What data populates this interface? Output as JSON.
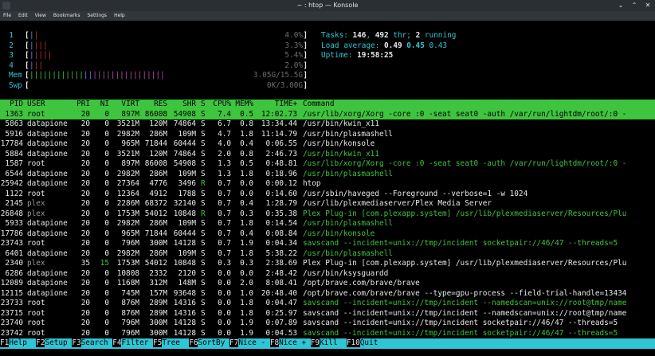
{
  "window": {
    "title": "~ : htop — Konsole"
  },
  "menu": [
    "File",
    "Edit",
    "View",
    "Bookmarks",
    "Settings",
    "Help"
  ],
  "meters": {
    "cpus": [
      {
        "label": "1",
        "value": "4.0%"
      },
      {
        "label": "2",
        "value": "3.3%"
      },
      {
        "label": "3",
        "value": "5.4%"
      },
      {
        "label": "4",
        "value": "2.0%"
      }
    ],
    "mem": {
      "label": "Mem",
      "value": "3.05G/15.5G"
    },
    "swp": {
      "label": "Swp",
      "value": "0K/3.00G"
    }
  },
  "summary": {
    "tasks_label": "Tasks: ",
    "tasks": "146",
    "thr": "492",
    "thr_label": " thr; ",
    "running": "2",
    "running_label": " running",
    "load_label": "Load average: ",
    "load1": "0.49",
    "load5": "0.45",
    "load15": "0.43",
    "uptime_label": "Uptime: ",
    "uptime": "19:58:25"
  },
  "columns": [
    "PID",
    "USER",
    "PRI",
    "NI",
    "VIRT",
    "RES",
    "SHR",
    "S",
    "CPU%",
    "MEM%",
    "TIME+",
    "Command"
  ],
  "processes": [
    {
      "pid": "1363",
      "user": "root",
      "pri": "20",
      "ni": "0",
      "virt": "897M",
      "res": "86008",
      "shr": "54908",
      "s": "S",
      "cpu": "7.4",
      "mem": "0.5",
      "time": "12:02.73",
      "cmd": "/usr/lib/xorg/Xorg -core :0 -seat seat0 -auth /var/run/lightdm/root/:0 -",
      "selected": true,
      "thread": false
    },
    {
      "pid": "5863",
      "user": "datapione",
      "pri": "20",
      "ni": "0",
      "virt": "3521M",
      "res": "120M",
      "shr": "74864",
      "s": "S",
      "cpu": "6.7",
      "mem": "0.8",
      "time": "13:34.44",
      "cmd": "/usr/bin/kwin_x11",
      "selected": false,
      "thread": false
    },
    {
      "pid": "5916",
      "user": "datapione",
      "pri": "20",
      "ni": "0",
      "virt": "2982M",
      "res": "286M",
      "shr": "109M",
      "s": "S",
      "cpu": "4.7",
      "mem": "1.8",
      "time": "11:14.79",
      "cmd": "/usr/bin/plasmashell",
      "selected": false,
      "thread": false
    },
    {
      "pid": "17784",
      "user": "datapione",
      "pri": "20",
      "ni": "0",
      "virt": "965M",
      "res": "71844",
      "shr": "60444",
      "s": "S",
      "cpu": "4.0",
      "mem": "0.4",
      "time": "0:06.55",
      "cmd": "/usr/bin/konsole",
      "selected": false,
      "thread": false
    },
    {
      "pid": "5884",
      "user": "datapione",
      "pri": "20",
      "ni": "0",
      "virt": "3521M",
      "res": "120M",
      "shr": "74864",
      "s": "S",
      "cpu": "2.0",
      "mem": "0.8",
      "time": "2:46.73",
      "cmd": "/usr/bin/kwin_x11",
      "selected": false,
      "thread": true
    },
    {
      "pid": "1587",
      "user": "root",
      "pri": "20",
      "ni": "0",
      "virt": "897M",
      "res": "86008",
      "shr": "54908",
      "s": "S",
      "cpu": "1.3",
      "mem": "0.5",
      "time": "0:48.81",
      "cmd": "/usr/lib/xorg/Xorg -core :0 -seat seat0 -auth /var/run/lightdm/root/:0 -",
      "selected": false,
      "thread": true
    },
    {
      "pid": "6544",
      "user": "datapione",
      "pri": "20",
      "ni": "0",
      "virt": "2982M",
      "res": "286M",
      "shr": "109M",
      "s": "S",
      "cpu": "1.3",
      "mem": "1.8",
      "time": "0:18.96",
      "cmd": "/usr/bin/plasmashell",
      "selected": false,
      "thread": true
    },
    {
      "pid": "25942",
      "user": "datapione",
      "pri": "20",
      "ni": "0",
      "virt": "27364",
      "res": "4776",
      "shr": "3496",
      "s": "R",
      "cpu": "0.7",
      "mem": "0.0",
      "time": "0:00.12",
      "cmd": "htop",
      "selected": false,
      "thread": false
    },
    {
      "pid": "1122",
      "user": "root",
      "pri": "20",
      "ni": "0",
      "virt": "12364",
      "res": "4912",
      "shr": "1788",
      "s": "S",
      "cpu": "0.7",
      "mem": "0.0",
      "time": "0:14.60",
      "cmd": "/usr/sbin/haveged --Foreground --verbose=1 -w 1024",
      "selected": false,
      "thread": false
    },
    {
      "pid": "2145",
      "user": "plex",
      "pri": "20",
      "ni": "0",
      "virt": "2286M",
      "res": "68372",
      "shr": "32140",
      "s": "S",
      "cpu": "0.7",
      "mem": "0.4",
      "time": "1:28.79",
      "cmd": "/usr/lib/plexmediaserver/Plex Media Server",
      "selected": false,
      "thread": false
    },
    {
      "pid": "26848",
      "user": "plex",
      "pri": "20",
      "ni": "0",
      "virt": "1753M",
      "res": "54012",
      "shr": "10848",
      "s": "R",
      "cpu": "0.7",
      "mem": "0.3",
      "time": "0:35.38",
      "cmd": "Plex Plug-in [com.plexapp.system] /usr/lib/plexmediaserver/Resources/Plu",
      "selected": false,
      "thread": true
    },
    {
      "pid": "5933",
      "user": "datapione",
      "pri": "20",
      "ni": "0",
      "virt": "2982M",
      "res": "286M",
      "shr": "109M",
      "s": "S",
      "cpu": "0.7",
      "mem": "1.8",
      "time": "0:14.54",
      "cmd": "/usr/bin/plasmashell",
      "selected": false,
      "thread": true
    },
    {
      "pid": "17786",
      "user": "datapione",
      "pri": "20",
      "ni": "0",
      "virt": "965M",
      "res": "71844",
      "shr": "60444",
      "s": "S",
      "cpu": "0.7",
      "mem": "0.4",
      "time": "0:08.84",
      "cmd": "/usr/bin/konsole",
      "selected": false,
      "thread": true
    },
    {
      "pid": "23743",
      "user": "root",
      "pri": "20",
      "ni": "0",
      "virt": "796M",
      "res": "300M",
      "shr": "14128",
      "s": "S",
      "cpu": "0.7",
      "mem": "1.9",
      "time": "0:04.34",
      "cmd": "savscand --incident=unix://tmp/incident socketpair://46/47 --threads=5",
      "selected": false,
      "thread": true
    },
    {
      "pid": "6401",
      "user": "datapione",
      "pri": "20",
      "ni": "0",
      "virt": "2982M",
      "res": "286M",
      "shr": "109M",
      "s": "S",
      "cpu": "0.7",
      "mem": "1.8",
      "time": "5:38.22",
      "cmd": "/usr/bin/plasmashell",
      "selected": false,
      "thread": true
    },
    {
      "pid": "2340",
      "user": "plex",
      "pri": "35",
      "ni": "15",
      "virt": "1753M",
      "res": "54012",
      "shr": "10848",
      "s": "S",
      "cpu": "0.3",
      "mem": "0.3",
      "time": "2:38.69",
      "cmd": "Plex Plug-in [com.plexapp.system] /usr/lib/plexmediaserver/Resources/Plu",
      "selected": false,
      "thread": false,
      "nice": true
    },
    {
      "pid": "6286",
      "user": "datapione",
      "pri": "20",
      "ni": "0",
      "virt": "10808",
      "res": "2332",
      "shr": "2120",
      "s": "S",
      "cpu": "0.0",
      "mem": "0.0",
      "time": "2:48.42",
      "cmd": "/usr/bin/ksysguardd",
      "selected": false,
      "thread": false
    },
    {
      "pid": "12089",
      "user": "datapione",
      "pri": "20",
      "ni": "0",
      "virt": "1168M",
      "res": "312M",
      "shr": "148M",
      "s": "S",
      "cpu": "0.0",
      "mem": "2.0",
      "time": "8:08.41",
      "cmd": "/opt/brave.com/brave/brave",
      "selected": false,
      "thread": false
    },
    {
      "pid": "12115",
      "user": "datapione",
      "pri": "20",
      "ni": "0",
      "virt": "745M",
      "res": "157M",
      "shr": "93648",
      "s": "S",
      "cpu": "0.0",
      "mem": "1.0",
      "time": "20:48.40",
      "cmd": "/opt/brave.com/brave/brave --type=gpu-process --field-trial-handle=13434",
      "selected": false,
      "thread": false
    },
    {
      "pid": "23733",
      "user": "root",
      "pri": "20",
      "ni": "0",
      "virt": "876M",
      "res": "289M",
      "shr": "14316",
      "s": "S",
      "cpu": "0.0",
      "mem": "1.8",
      "time": "0:04.47",
      "cmd": "savscand --incident=unix://tmp/incident --namedscan=unix://root@tmp/name",
      "selected": false,
      "thread": true
    },
    {
      "pid": "23715",
      "user": "root",
      "pri": "20",
      "ni": "0",
      "virt": "876M",
      "res": "289M",
      "shr": "14316",
      "s": "S",
      "cpu": "0.0",
      "mem": "1.8",
      "time": "0:25.97",
      "cmd": "savscand --incident=unix://tmp/incident --namedscan=unix://root@tmp/name",
      "selected": false,
      "thread": false
    },
    {
      "pid": "23740",
      "user": "root",
      "pri": "20",
      "ni": "0",
      "virt": "796M",
      "res": "300M",
      "shr": "14128",
      "s": "S",
      "cpu": "0.0",
      "mem": "1.9",
      "time": "0:07.89",
      "cmd": "savscand --incident=unix://tmp/incident socketpair://46/47 --threads=5",
      "selected": false,
      "thread": false
    },
    {
      "pid": "23742",
      "user": "root",
      "pri": "20",
      "ni": "0",
      "virt": "796M",
      "res": "300M",
      "shr": "14128",
      "s": "S",
      "cpu": "0.0",
      "mem": "1.9",
      "time": "0:04.53",
      "cmd": "savscand --incident=unix://tmp/incident socketpair://46/47 --threads=5",
      "selected": false,
      "thread": true
    }
  ],
  "footer": [
    {
      "key": "F1",
      "label": "Help"
    },
    {
      "key": "F2",
      "label": "Setup"
    },
    {
      "key": "F3",
      "label": "Search"
    },
    {
      "key": "F4",
      "label": "Filter"
    },
    {
      "key": "F5",
      "label": "Tree"
    },
    {
      "key": "F6",
      "label": "SortBy"
    },
    {
      "key": "F7",
      "label": "Nice -"
    },
    {
      "key": "F8",
      "label": "Nice +"
    },
    {
      "key": "F9",
      "label": "Kill"
    },
    {
      "key": "F10",
      "label": "Quit"
    }
  ],
  "colors": {
    "header_bg": "#3ec43e",
    "footer_bg": "#2ec5d5",
    "label": "#2ec5d5",
    "thread": "#3ec43e"
  }
}
